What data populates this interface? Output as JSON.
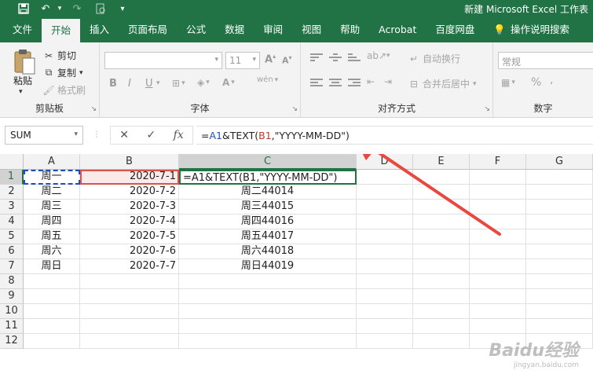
{
  "window": {
    "title": "新建 Microsoft Excel 工作表"
  },
  "ribbon_tabs": [
    "文件",
    "开始",
    "插入",
    "页面布局",
    "公式",
    "数据",
    "审阅",
    "视图",
    "帮助",
    "Acrobat",
    "百度网盘",
    "操作说明搜索"
  ],
  "active_tab": "开始",
  "clipboard": {
    "paste": "粘贴",
    "cut": "剪切",
    "copy": "复制",
    "format_painter": "格式刷",
    "label": "剪贴板"
  },
  "font": {
    "size": "11",
    "label": "字体"
  },
  "alignment": {
    "wrap": "自动换行",
    "merge": "合并后居中",
    "label": "对齐方式"
  },
  "number": {
    "format": "常规",
    "label": "数字",
    "percent": "%"
  },
  "formula_bar": {
    "name_box": "SUM",
    "formula_parts": [
      "=",
      "A1",
      "&TEXT(",
      "B1",
      ",\"YYYY-MM-DD\")"
    ]
  },
  "columns": [
    "A",
    "B",
    "C",
    "D",
    "E",
    "F",
    "G"
  ],
  "rows": [
    "1",
    "2",
    "3",
    "4",
    "5",
    "6",
    "7",
    "8",
    "9",
    "10",
    "11",
    "12"
  ],
  "cells": [
    {
      "a": "周一",
      "b": "2020-7-1",
      "c": "=A1&TEXT(B1,\"YYYY-MM-DD\")"
    },
    {
      "a": "周二",
      "b": "2020-7-2",
      "c": "周二44014"
    },
    {
      "a": "周三",
      "b": "2020-7-3",
      "c": "周三44015"
    },
    {
      "a": "周四",
      "b": "2020-7-4",
      "c": "周四44016"
    },
    {
      "a": "周五",
      "b": "2020-7-5",
      "c": "周五44017"
    },
    {
      "a": "周六",
      "b": "2020-7-6",
      "c": "周六44018"
    },
    {
      "a": "周日",
      "b": "2020-7-7",
      "c": "周日44019"
    }
  ],
  "watermark": {
    "brand": "Baidu经验",
    "url": "jingyan.baidu.com"
  },
  "colors": {
    "excel_green": "#217346",
    "arrow": "#e8483d",
    "ref_blue": "#1e4fb8",
    "ref_red": "#d9534f"
  }
}
